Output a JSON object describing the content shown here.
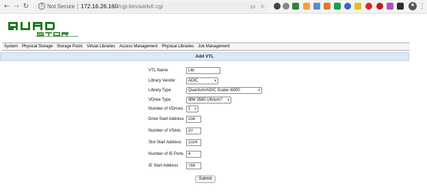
{
  "browser": {
    "not_secure": "Not Secure",
    "url_host": "172.16.26.160",
    "url_path": "/cgi-bin/addvtl.cgi",
    "icons": [
      "back-icon",
      "forward-icon",
      "reload-icon",
      "info-icon",
      "cast-icon",
      "bookmark-star-icon",
      "avatar",
      "menu-icon"
    ]
  },
  "logo": {
    "text_top": "QUAD",
    "text_bottom": "STOR",
    "color": "#1f7a1f"
  },
  "menu": {
    "items": [
      "System",
      "Physical Storage",
      "Storage Pools",
      "Virtual Libraries",
      "Access Management",
      "Physical Libraries",
      "Job Management"
    ]
  },
  "page": {
    "title": "Add VTL",
    "header_color": "#dce8f4"
  },
  "form": {
    "vtl_name": {
      "label": "VTL Name",
      "value": "LIB"
    },
    "library_vendor": {
      "label": "Library Vendor",
      "value": "ADIC"
    },
    "library_type": {
      "label": "Library Type",
      "value": "Quantum/ADIC Scalar i6000"
    },
    "vdrive_type": {
      "label": "VDrive Type",
      "value": "IBM 3580 Ultrium7"
    },
    "num_vdrives": {
      "label": "Number of VDrives",
      "value": "1"
    },
    "drive_start_address": {
      "label": "Drive Start Address",
      "value": "256"
    },
    "num_vslots": {
      "label": "Number of VSlots",
      "value": "20"
    },
    "slot_start_address": {
      "label": "Slot Start Address",
      "value": "1024"
    },
    "num_ie_ports": {
      "label": "Number of IE Ports",
      "value": "4"
    },
    "ie_start_address": {
      "label": "IE Start Address",
      "value": "768"
    },
    "submit_label": "Submit"
  }
}
